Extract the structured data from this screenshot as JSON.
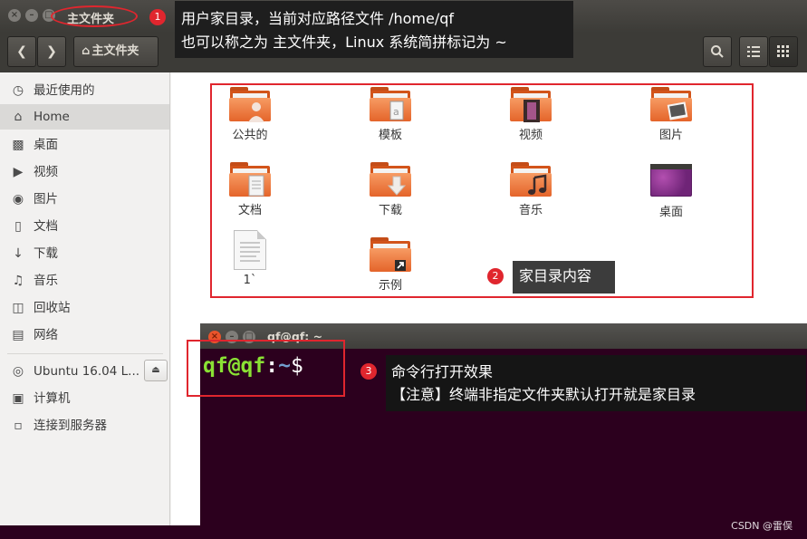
{
  "window": {
    "title": "主文件夹",
    "breadcrumb": "主文件夹",
    "buttons": {
      "close": "×",
      "minimize": "–",
      "maximize": "□"
    }
  },
  "sidebar": {
    "items": [
      {
        "label": "最近使用的",
        "icon": "clock-icon"
      },
      {
        "label": "Home",
        "icon": "home-icon"
      },
      {
        "label": "桌面",
        "icon": "folder-icon"
      },
      {
        "label": "视频",
        "icon": "video-icon"
      },
      {
        "label": "图片",
        "icon": "camera-icon"
      },
      {
        "label": "文档",
        "icon": "document-icon"
      },
      {
        "label": "下载",
        "icon": "download-icon"
      },
      {
        "label": "音乐",
        "icon": "music-icon"
      },
      {
        "label": "回收站",
        "icon": "trash-icon"
      },
      {
        "label": "网络",
        "icon": "network-icon"
      }
    ],
    "devices": [
      {
        "label": "Ubuntu 16.04 L...",
        "icon": "disc-icon"
      },
      {
        "label": "计算机",
        "icon": "computer-icon"
      },
      {
        "label": "连接到服务器",
        "icon": "server-icon"
      }
    ]
  },
  "files": [
    {
      "label": "公共的",
      "icon": "person-icon"
    },
    {
      "label": "模板",
      "icon": "template-icon"
    },
    {
      "label": "视频",
      "icon": "film-icon"
    },
    {
      "label": "图片",
      "icon": "picture-icon"
    },
    {
      "label": "文档",
      "icon": "document-icon"
    },
    {
      "label": "下载",
      "icon": "download-arrow-icon"
    },
    {
      "label": "音乐",
      "icon": "music-note-icon"
    },
    {
      "label": "桌面",
      "icon": "desktop-icon"
    },
    {
      "label": "1`",
      "icon": "text-file-icon"
    },
    {
      "label": "示例",
      "icon": "shortcut-icon"
    }
  ],
  "terminal": {
    "title": "qf@qf: ~",
    "prompt_user": "qf@qf",
    "prompt_colon": ":",
    "prompt_path": "~",
    "prompt_symbol": "$"
  },
  "annotations": {
    "note1": {
      "num": "1",
      "line1": "用户家目录，当前对应路径文件 /home/qf",
      "line2": "也可以称之为 主文件夹，Linux 系统简拼标记为 ~"
    },
    "note2": {
      "num": "2",
      "text": "家目录内容"
    },
    "note3": {
      "num": "3",
      "line1": "命令行打开效果",
      "line2": "【注意】终端非指定文件夹默认打开就是家目录"
    }
  },
  "watermark": "CSDN @雷俣",
  "colors": {
    "accent_red": "#e0262e",
    "folder_orange": "#e4642a",
    "terminal_bg": "#2c001e",
    "prompt_green": "#8ae234",
    "prompt_blue": "#729fcf"
  }
}
